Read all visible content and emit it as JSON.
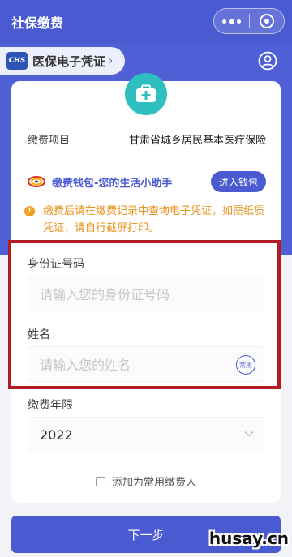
{
  "app": {
    "title": "社保缴费"
  },
  "header": {
    "pill_label": "医保电子凭证",
    "logo_text": "CHS"
  },
  "form": {
    "item_label": "缴费项目",
    "item_value": "甘肃省城乡居民基本医疗保险",
    "wallet_text": "缴费钱包-您的生活小助手",
    "wallet_button": "进入钱包",
    "notice_text": "缴费后请在缴费记录中查询电子凭证，如需纸质凭证，请自行截屏打印。",
    "id_label": "身份证号码",
    "id_placeholder": "请输入您的身份证号码",
    "name_label": "姓名",
    "name_placeholder": "请输入您的姓名",
    "common_badge": "常用",
    "year_label": "缴费年限",
    "year_value": "2022",
    "checkbox_label": "添加为常用缴费人",
    "next_button": "下一步"
  },
  "watermark": "husay.cn",
  "colors": {
    "primary": "#4a5bd2",
    "teal": "#2ebfc1",
    "warning": "#e8921b",
    "highlight": "#b31b24"
  }
}
